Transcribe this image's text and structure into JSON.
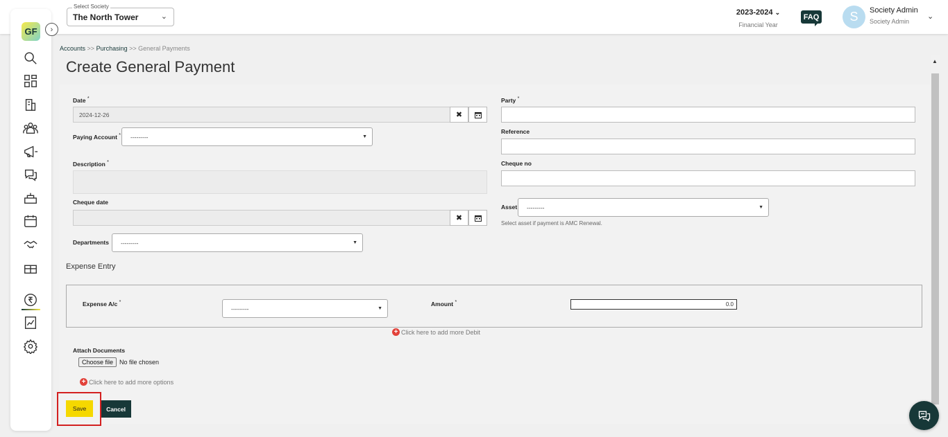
{
  "header": {
    "society_label": "Select Society",
    "society_value": "The North Tower",
    "financial_year": "2023-2024",
    "financial_year_label": "Financial Year",
    "faq_label": "FAQ",
    "avatar_letter": "S",
    "user_name": "Society Admin",
    "user_role": "Society Admin"
  },
  "sidebar": {
    "logo_text": "GF",
    "items": [
      "search-icon",
      "dashboard-icon",
      "building-icon",
      "members-icon",
      "megaphone-icon",
      "chat-icon",
      "facility-icon",
      "calendar-icon",
      "handshake-icon",
      "gift-icon",
      "rupee-icon",
      "report-icon",
      "settings-icon"
    ],
    "active_item": "rupee-icon"
  },
  "breadcrumb": {
    "item1": "Accounts",
    "sep1": ">>",
    "item2": "Purchasing",
    "sep2": ">>",
    "current": "General Payments"
  },
  "page": {
    "title": "Create General Payment"
  },
  "form": {
    "date_label": "Date",
    "date_value": "2024-12-26",
    "party_label": "Party",
    "party_value": "",
    "paying_account_label": "Paying Account",
    "paying_account_value": "---------",
    "reference_label": "Reference",
    "reference_value": "",
    "description_label": "Description",
    "cheque_no_label": "Cheque no",
    "cheque_no_value": "",
    "cheque_date_label": "Cheque date",
    "cheque_date_value": "",
    "asset_label": "Asset",
    "asset_value": "---------",
    "asset_help": "Select asset if payment is AMC Renewal.",
    "departments_label": "Departments",
    "departments_value": "---------",
    "required_mark": "*",
    "clear_glyph": "✖"
  },
  "expense": {
    "section_title": "Expense Entry",
    "account_label": "Expense A/c",
    "account_value": "---------",
    "amount_label": "Amount",
    "amount_value": "0.0",
    "add_debit_text": "Click here to add more Debit"
  },
  "attachments": {
    "label": "Attach Documents",
    "choose_file": "Choose file",
    "no_file": "No file chosen",
    "add_options_text": "Click here to add more options"
  },
  "actions": {
    "save_label": "Save",
    "cancel_label": "Cancel"
  },
  "colors": {
    "brand_dark": "#173838",
    "save_yellow": "#f5d800",
    "highlight_red": "#d32020",
    "add_red": "#e2423a"
  }
}
